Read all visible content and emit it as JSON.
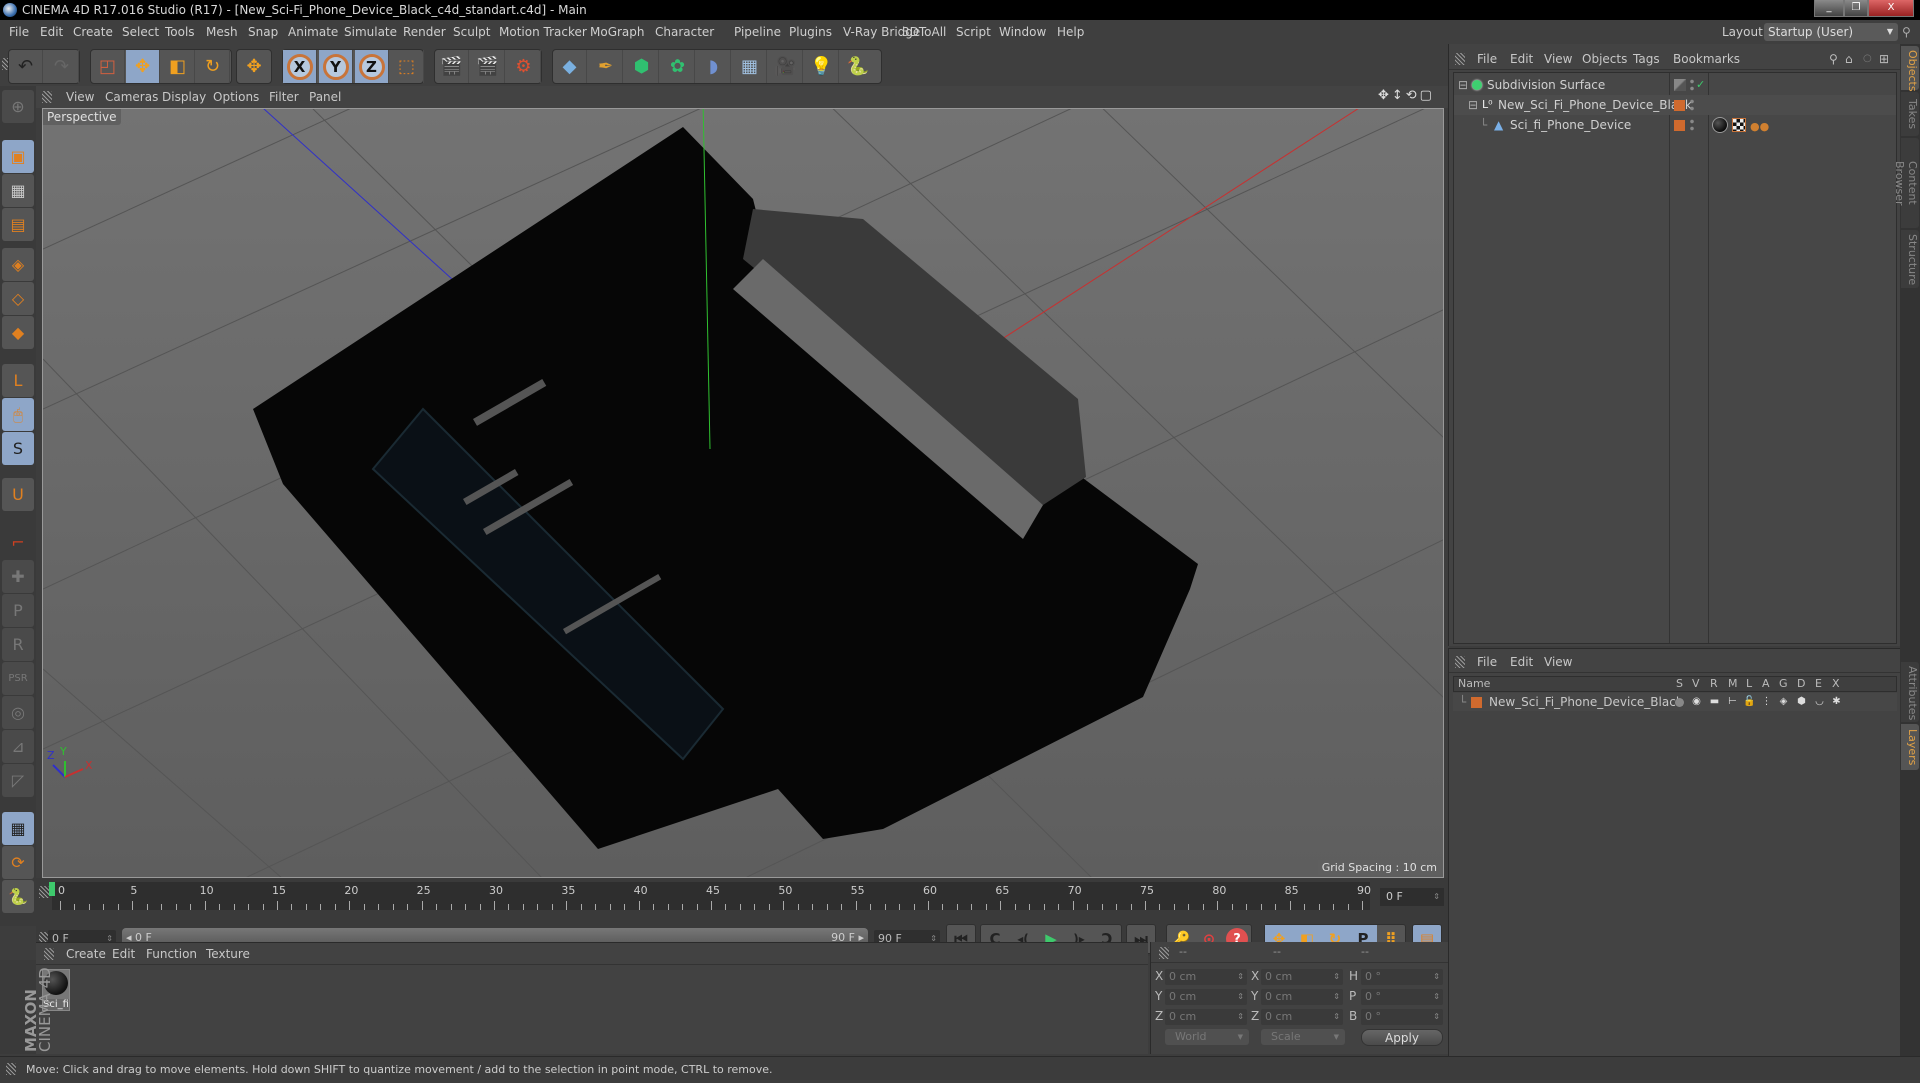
{
  "window": {
    "title": "CINEMA 4D R17.016 Studio (R17) - [New_Sci-Fi_Phone_Device_Black_c4d_standart.c4d] - Main",
    "minimize_label": "_",
    "restore_label": "❐",
    "close_label": "X"
  },
  "menubar": {
    "items": [
      "File",
      "Edit",
      "Create",
      "Select",
      "Tools",
      "Mesh",
      "Snap",
      "Animate",
      "Simulate",
      "Render",
      "Sculpt",
      "Motion Tracker",
      "MoGraph",
      "Character",
      "Pipeline",
      "Plugins",
      "V-Ray Bridge",
      "3DToAll",
      "Script",
      "Window",
      "Help"
    ],
    "layout_label": "Layout:",
    "layout_value": "Startup (User)"
  },
  "toolbar": {
    "undo": "↶",
    "redo": "↷",
    "live_select": "◰",
    "move": "✥",
    "scale": "◧",
    "rotate": "↻",
    "recent_tool": "✥",
    "axis_x": "X",
    "axis_y": "Y",
    "axis_z": "Z",
    "coord_system": "⬚",
    "render_view": "🎬",
    "render_picture": "🎬",
    "render_settings": "⚙",
    "cube": "◆",
    "pen": "✒",
    "subdivision": "⬢",
    "cloner": "✿",
    "deformer": "◗",
    "floor": "▦",
    "camera": "🎥",
    "light": "💡",
    "python": "🐍"
  },
  "left_tools": [
    "⊕",
    "▣",
    "▦",
    "▤",
    "◈",
    "◇",
    "◆",
    "L",
    "🖱",
    "S",
    "U",
    "⌐",
    "✚",
    "P",
    "R",
    "PSR",
    "◎",
    "⊿",
    "◸",
    "▦",
    "⟳",
    "🐍"
  ],
  "viewport": {
    "menu": [
      "View",
      "Cameras",
      "Display",
      "Options",
      "Filter",
      "Panel"
    ],
    "label": "Perspective",
    "grid_spacing": "Grid Spacing : 10 cm",
    "nav_icons": "✥↕⟲▢",
    "axis_x": "X",
    "axis_y": "Y",
    "axis_z": "Z",
    "colors": {
      "x_axis": "#c83030",
      "y_axis": "#30c030",
      "z_axis": "#3030c8"
    }
  },
  "timeline": {
    "ticks": [
      0,
      5,
      10,
      15,
      20,
      25,
      30,
      35,
      40,
      45,
      50,
      55,
      60,
      65,
      70,
      75,
      80,
      85,
      90
    ],
    "current_frame": "0 F",
    "start_field": "0 F",
    "range_start": "◂ 0 F",
    "range_end": "90 F ▸",
    "end_field": "90 F"
  },
  "transport": {
    "first": "⏮",
    "prev_key": "C",
    "prev_frame": "◂(",
    "play": "▶",
    "next_frame": ")▸",
    "next_key": "Ↄ",
    "last": "⏭",
    "record_disabled": "🔑",
    "autokey": "⊙",
    "key_help": "?",
    "key_pos": "✥",
    "key_scale": "◧",
    "key_rot": "↻",
    "key_param": "P",
    "key_pla": "⠿",
    "timeline_btn": "▤"
  },
  "material_manager": {
    "menu": [
      "Create",
      "Edit",
      "Function",
      "Texture"
    ],
    "materials": [
      {
        "name": "Sci_fi"
      }
    ]
  },
  "branding": {
    "maxon": "MAXON",
    "product": "CINEMA 4D"
  },
  "coordinates": {
    "headers": [
      "--",
      "--",
      "--"
    ],
    "rows": [
      {
        "l1": "X",
        "v1": "0 cm",
        "l2": "X",
        "v2": "0 cm",
        "l3": "H",
        "v3": "0 °"
      },
      {
        "l1": "Y",
        "v1": "0 cm",
        "l2": "Y",
        "v2": "0 cm",
        "l3": "P",
        "v3": "0 °"
      },
      {
        "l1": "Z",
        "v1": "0 cm",
        "l2": "Z",
        "v2": "0 cm",
        "l3": "B",
        "v3": "0 °"
      }
    ],
    "mode_select": "World",
    "size_select": "Scale",
    "apply_label": "Apply"
  },
  "status": {
    "text": "Move: Click and drag to move elements. Hold down SHIFT to quantize movement / add to the selection in point mode, CTRL to remove."
  },
  "object_manager": {
    "menu": [
      "File",
      "Edit",
      "View",
      "Objects",
      "Tags",
      "Bookmarks"
    ],
    "objects": [
      {
        "name": "Subdivision Surface",
        "indent": 0
      },
      {
        "name": "New_Sci_Fi_Phone_Device_Black",
        "indent": 1
      },
      {
        "name": "Sci_fi_Phone_Device",
        "indent": 2
      }
    ]
  },
  "side_tabs": {
    "top": [
      "Objects",
      "Takes",
      "Content Browser",
      "Structure"
    ],
    "bottom": [
      "Attributes",
      "Layers"
    ]
  },
  "layer_manager": {
    "menu": [
      "File",
      "Edit",
      "View"
    ],
    "columns": [
      "Name",
      "S",
      "V",
      "R",
      "M",
      "L",
      "A",
      "G",
      "D",
      "E",
      "X"
    ],
    "layers": [
      {
        "name": "New_Sci_Fi_Phone_Device_Black",
        "color": "#d06a2e"
      }
    ]
  }
}
